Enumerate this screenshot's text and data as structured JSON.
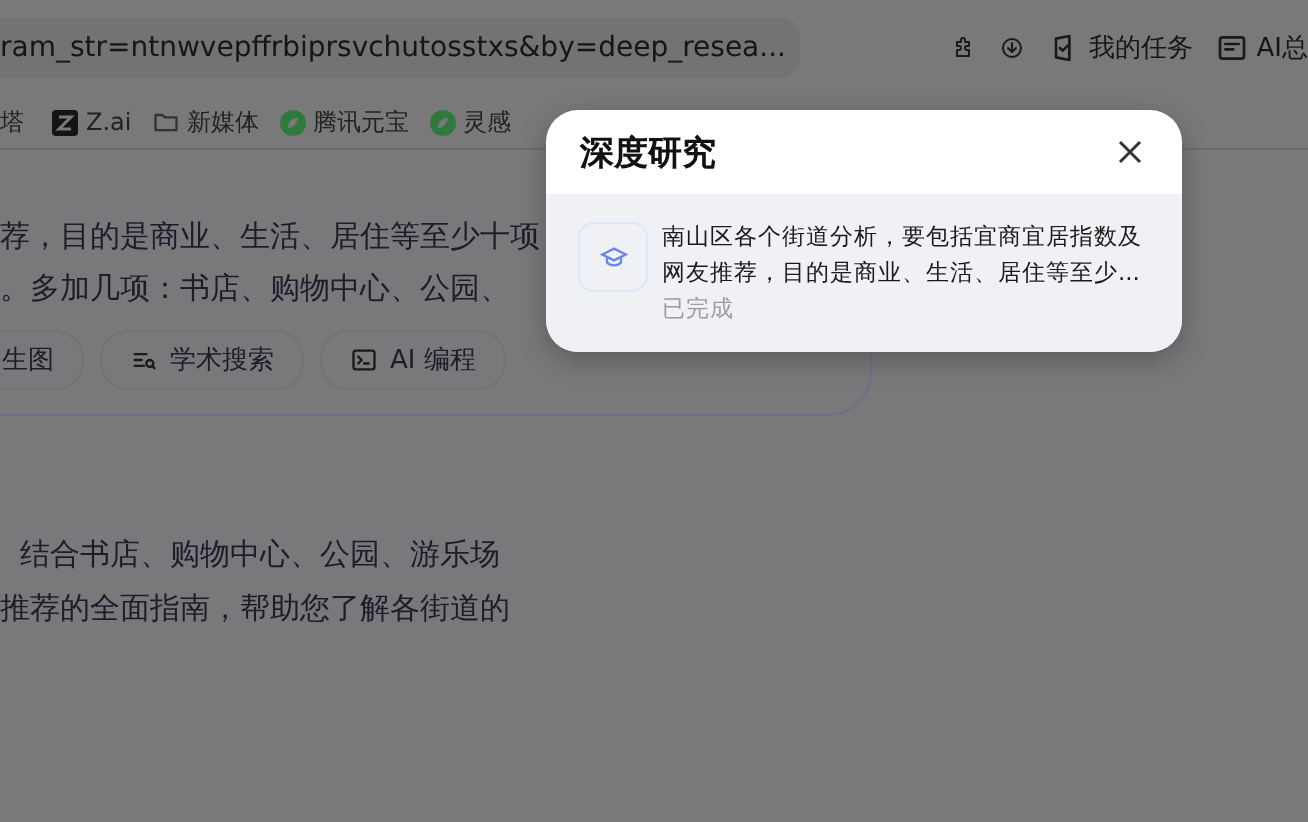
{
  "browser": {
    "address": "ram_str=ntnwvepffrbiprsvchutosstxs&by=deep_resea...",
    "toolbar": [
      {
        "kind": "extensions"
      },
      {
        "kind": "download"
      },
      {
        "kind": "tasks",
        "label": "我的任务"
      },
      {
        "kind": "summary",
        "label": "AI总"
      }
    ]
  },
  "bookmarks": [
    {
      "kind": "text",
      "label": "塔"
    },
    {
      "kind": "zai",
      "label": "Z.ai"
    },
    {
      "kind": "folder",
      "label": "新媒体"
    },
    {
      "kind": "leaf",
      "label": "腾讯元宝"
    },
    {
      "kind": "leaf",
      "label": "灵感"
    }
  ],
  "prompt": {
    "lines": [
      "荐，目的是商业、生活、居住等至少十项",
      "。多加几项：书店、购物中心、公园、"
    ],
    "chips": [
      {
        "kind": "image",
        "label": "生图"
      },
      {
        "kind": "search",
        "label": "学术搜索"
      },
      {
        "kind": "code",
        "label": "AI 编程"
      }
    ]
  },
  "answer": {
    "lines": [
      "结合书店、购物中心、公园、游乐场",
      "推荐的全面指南，帮助您了解各街道的"
    ]
  },
  "dialog": {
    "title": "深度研究",
    "tasks": [
      {
        "text": "南山区各个街道分析，要包括宜商宜居指数及网友推荐，目的是商业、生活、居住等至少...",
        "status": "已完成"
      }
    ]
  }
}
